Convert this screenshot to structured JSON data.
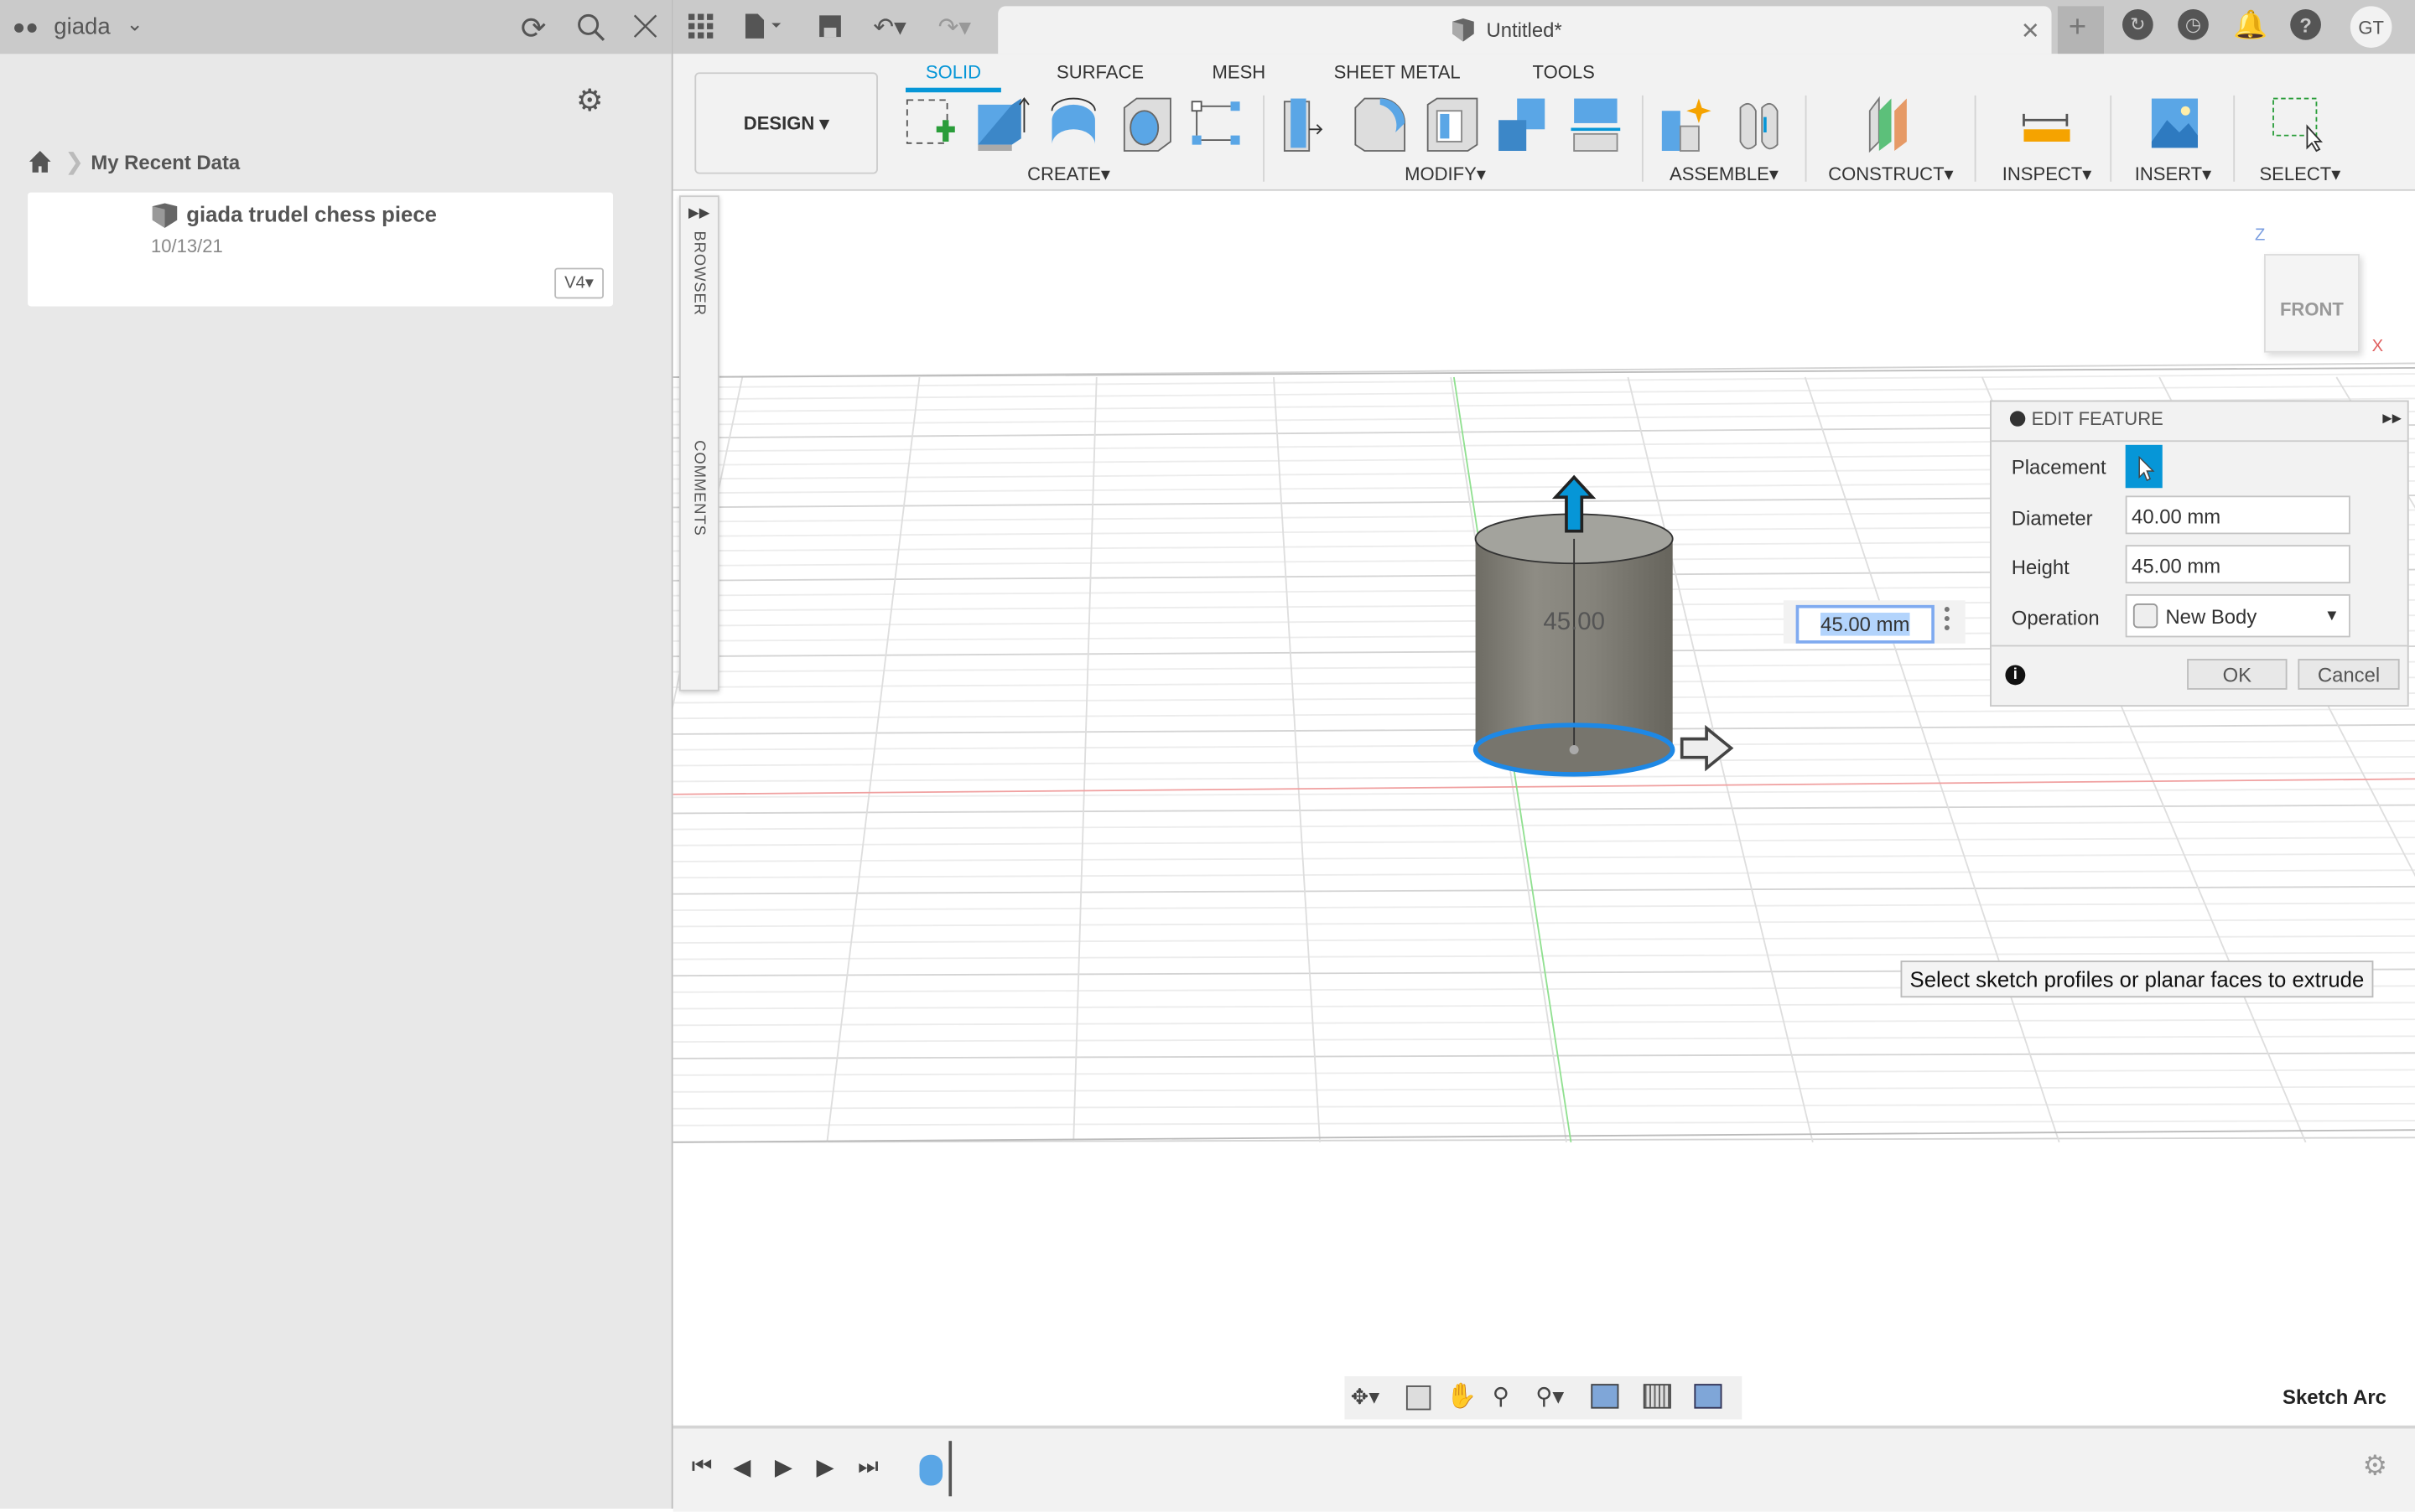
{
  "left_panel": {
    "team_name": "giada",
    "breadcrumb": "My Recent Data",
    "files": [
      {
        "name": "giada trudel chess piece",
        "date": "10/13/21",
        "version": "V4"
      }
    ]
  },
  "toolbar": {
    "document_title": "Untitled*",
    "avatar": "GT",
    "workspace": "DESIGN",
    "tabs": [
      "SOLID",
      "SURFACE",
      "MESH",
      "SHEET METAL",
      "TOOLS"
    ],
    "active_tab": "SOLID",
    "groups": [
      "CREATE",
      "MODIFY",
      "ASSEMBLE",
      "CONSTRUCT",
      "INSPECT",
      "INSERT",
      "SELECT"
    ]
  },
  "side_tabs": {
    "browser": "BROWSER",
    "comments": "COMMENTS"
  },
  "view_cube": {
    "face": "FRONT",
    "z": "Z",
    "x": "X"
  },
  "viewport": {
    "dimension_label": "45.00",
    "height_input": "45.00 mm",
    "tooltip": "Select sketch profiles or planar faces to extrude",
    "status": "Sketch Arc"
  },
  "edit_feature": {
    "title": "EDIT FEATURE",
    "placement_label": "Placement",
    "diameter_label": "Diameter",
    "diameter_value": "40.00 mm",
    "height_label": "Height",
    "height_value": "45.00 mm",
    "operation_label": "Operation",
    "operation_value": "New Body",
    "ok": "OK",
    "cancel": "Cancel"
  },
  "colors": {
    "accent": "#0696d7",
    "ribbon": "#f2f2f2",
    "topbar": "#cacaca"
  }
}
